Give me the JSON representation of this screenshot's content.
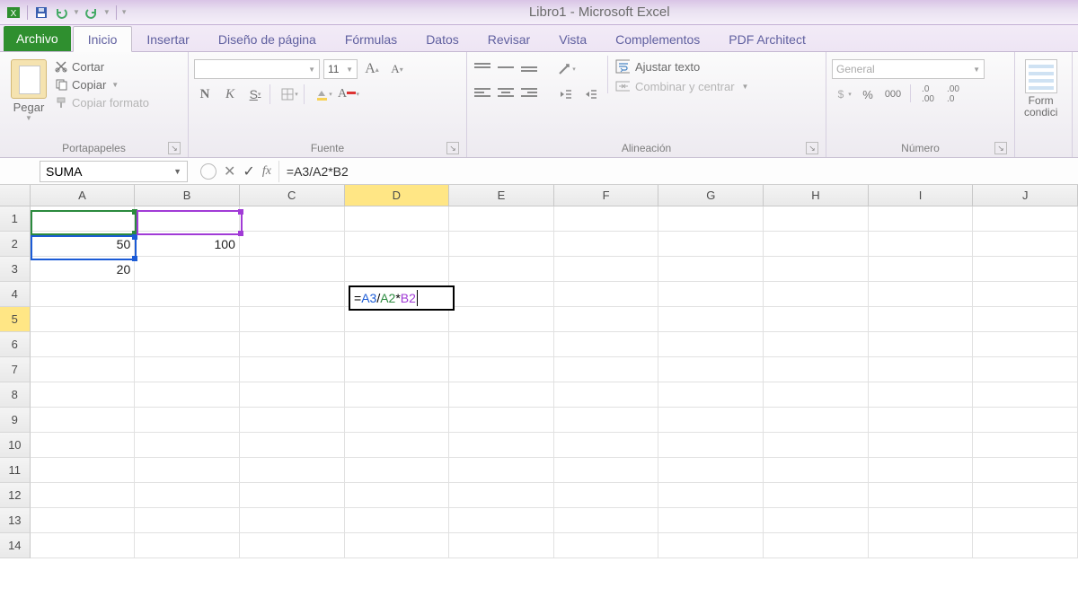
{
  "title": "Libro1 - Microsoft Excel",
  "qat": {
    "save": "save",
    "undo": "undo",
    "redo": "redo"
  },
  "tabs": {
    "file": "Archivo",
    "list": [
      "Inicio",
      "Insertar",
      "Diseño de página",
      "Fórmulas",
      "Datos",
      "Revisar",
      "Vista",
      "Complementos",
      "PDF Architect"
    ],
    "active_index": 0
  },
  "ribbon": {
    "portapapeles": {
      "label": "Portapapeles",
      "pegar": "Pegar",
      "cortar": "Cortar",
      "copiar": "Copiar",
      "copiar_formato": "Copiar formato"
    },
    "fuente": {
      "label": "Fuente",
      "font_name": "",
      "font_size": "11",
      "bold": "N",
      "italic": "K",
      "underline": "S"
    },
    "alineacion": {
      "label": "Alineación",
      "ajustar": "Ajustar texto",
      "combinar": "Combinar y centrar"
    },
    "numero": {
      "label": "Número",
      "format": "General",
      "percent": "%",
      "thousands": "000"
    },
    "formato_cond": {
      "line1": "Form",
      "line2": "condici"
    }
  },
  "formulabar": {
    "namebox": "SUMA",
    "fx": "fx",
    "formula": "=A3/A2*B2"
  },
  "grid": {
    "columns": [
      "A",
      "B",
      "C",
      "D",
      "E",
      "F",
      "G",
      "H",
      "I",
      "J"
    ],
    "active_col_index": 3,
    "rows": 14,
    "active_row_index": 4,
    "cells": {
      "A2": "50",
      "B2": "100",
      "A3": "20"
    },
    "editing": {
      "ref": "D5",
      "parts": {
        "eq": "=",
        "a3": "A3",
        "div": "/",
        "a2": "A2",
        "mul": "*",
        "b2": "B2"
      }
    }
  }
}
